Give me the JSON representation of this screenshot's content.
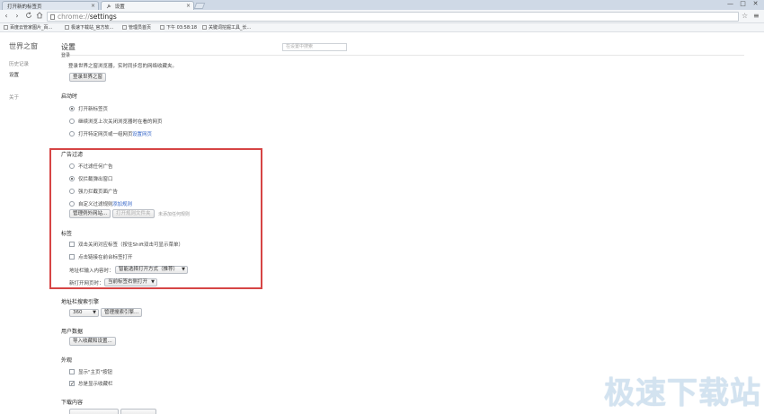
{
  "tabs": [
    {
      "label": "打开新的标签页"
    },
    {
      "label": "设置"
    }
  ],
  "window_controls": {
    "minimize": "—",
    "maximize": "□",
    "close": "✕"
  },
  "toolbar": {
    "url_scheme": "chrome://",
    "url_path": "settings"
  },
  "bookmarks": [
    {
      "label": "百度云管家图片_百..."
    },
    {
      "label": "极速下载站_官方软..."
    },
    {
      "label": "管理员首页"
    },
    {
      "label": "下午 03:58:18"
    },
    {
      "label": "关键词挖掘工具_长..."
    }
  ],
  "leftnav": {
    "brand": "世界之窗",
    "items": [
      {
        "label": "历史记录"
      },
      {
        "label": "设置"
      },
      {
        "label": "关于"
      }
    ]
  },
  "settings": {
    "title": "设置",
    "search_placeholder": "在设置中搜索",
    "signin": {
      "title": "登录",
      "desc": "登录世界之窗浏览器，实时同步您的网络收藏夹。",
      "button": "登录世界之窗"
    },
    "startup": {
      "title": "启动时",
      "options": [
        {
          "label": "打开新标签页",
          "checked": true
        },
        {
          "label": "继续浏览上次关闭浏览器时在看的网页",
          "checked": false
        },
        {
          "label": "打开特定网页或一组网页",
          "checked": false
        }
      ],
      "link": "设置网页"
    },
    "adfilter": {
      "title": "广告过滤",
      "options": [
        {
          "label": "不过滤任何广告",
          "checked": false
        },
        {
          "label": "仅拦截弹出窗口",
          "checked": true
        },
        {
          "label": "强力拦截页面广告",
          "checked": false
        },
        {
          "label": "自定义过滤规则",
          "checked": false
        }
      ],
      "link": "添加规则",
      "btn_exceptions": "管理例外网站...",
      "btn_open_rules": "打开规则文件夹",
      "note": "未添加任何规则"
    },
    "tabs_section": {
      "title": "标签",
      "checks": [
        {
          "label": "双击关闭对应标签（按住Shift双击可显示菜单）",
          "checked": false
        },
        {
          "label": "点击链接在前台标签打开",
          "checked": false
        }
      ],
      "addressbar_label": "地址栏输入内容时：",
      "addressbar_value": "智能选择打开方式（推荐）",
      "newtab_label": "新打开网页时：",
      "newtab_value": "当前标签右侧打开"
    },
    "search_engine": {
      "title": "地址栏搜索引擎",
      "value": "360",
      "button": "管理搜索引擎..."
    },
    "user_data": {
      "title": "用户数据",
      "button": "导入收藏和设置..."
    },
    "appearance": {
      "title": "外观",
      "checks": [
        {
          "label": "显示\"主页\"按钮",
          "checked": false
        },
        {
          "label": "总是显示收藏栏",
          "checked": true
        }
      ]
    },
    "downloads": {
      "title": "下载内容"
    }
  },
  "watermark": "极速下载站",
  "colors": {
    "highlight": "#d64545",
    "link": "#3465c8"
  }
}
